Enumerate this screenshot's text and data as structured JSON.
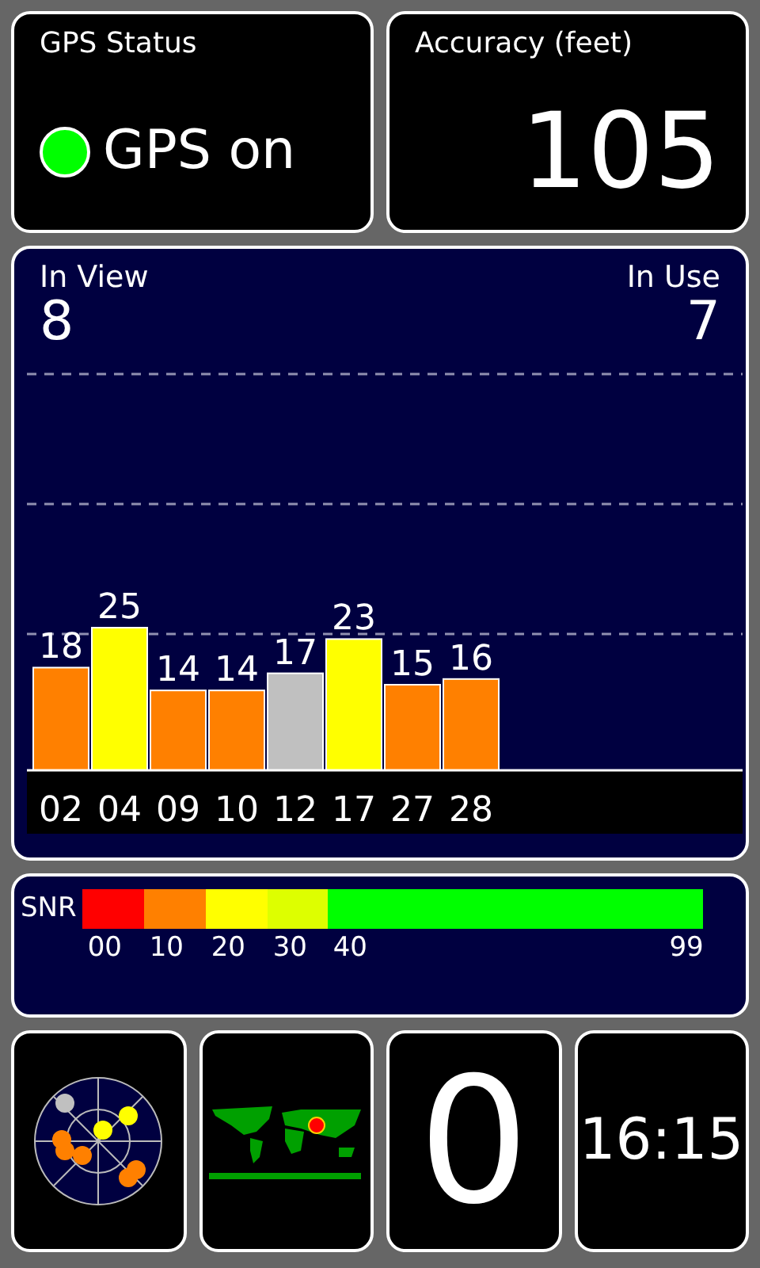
{
  "gps_status": {
    "title": "GPS Status",
    "on": true,
    "label": "GPS on"
  },
  "accuracy": {
    "title": "Accuracy (feet)",
    "value": "105"
  },
  "satellites": {
    "in_view_label": "In View",
    "in_view": "8",
    "in_use_label": "In Use",
    "in_use": "7",
    "in_use_flags": [
      true,
      true,
      true,
      true,
      false,
      true,
      true,
      true
    ],
    "chart_data": {
      "type": "bar",
      "categories": [
        "02",
        "04",
        "09",
        "10",
        "12",
        "17",
        "27",
        "28"
      ],
      "series": [
        {
          "values": [
            18,
            25,
            14,
            14,
            17,
            23,
            15,
            16
          ]
        }
      ],
      "data_labels": true
    }
  },
  "snr_legend": {
    "label": "SNR",
    "bands": [
      {
        "label": "00",
        "color": "#ff0000"
      },
      {
        "label": "10",
        "color": "#ff8000"
      },
      {
        "label": "20",
        "color": "#ffff00"
      },
      {
        "label": "30",
        "color": "#ddff00"
      },
      {
        "label": "40",
        "color": "#00ff00"
      }
    ],
    "end_label": "99"
  },
  "counter": {
    "value": "0"
  },
  "clock": {
    "time": "16:15"
  }
}
